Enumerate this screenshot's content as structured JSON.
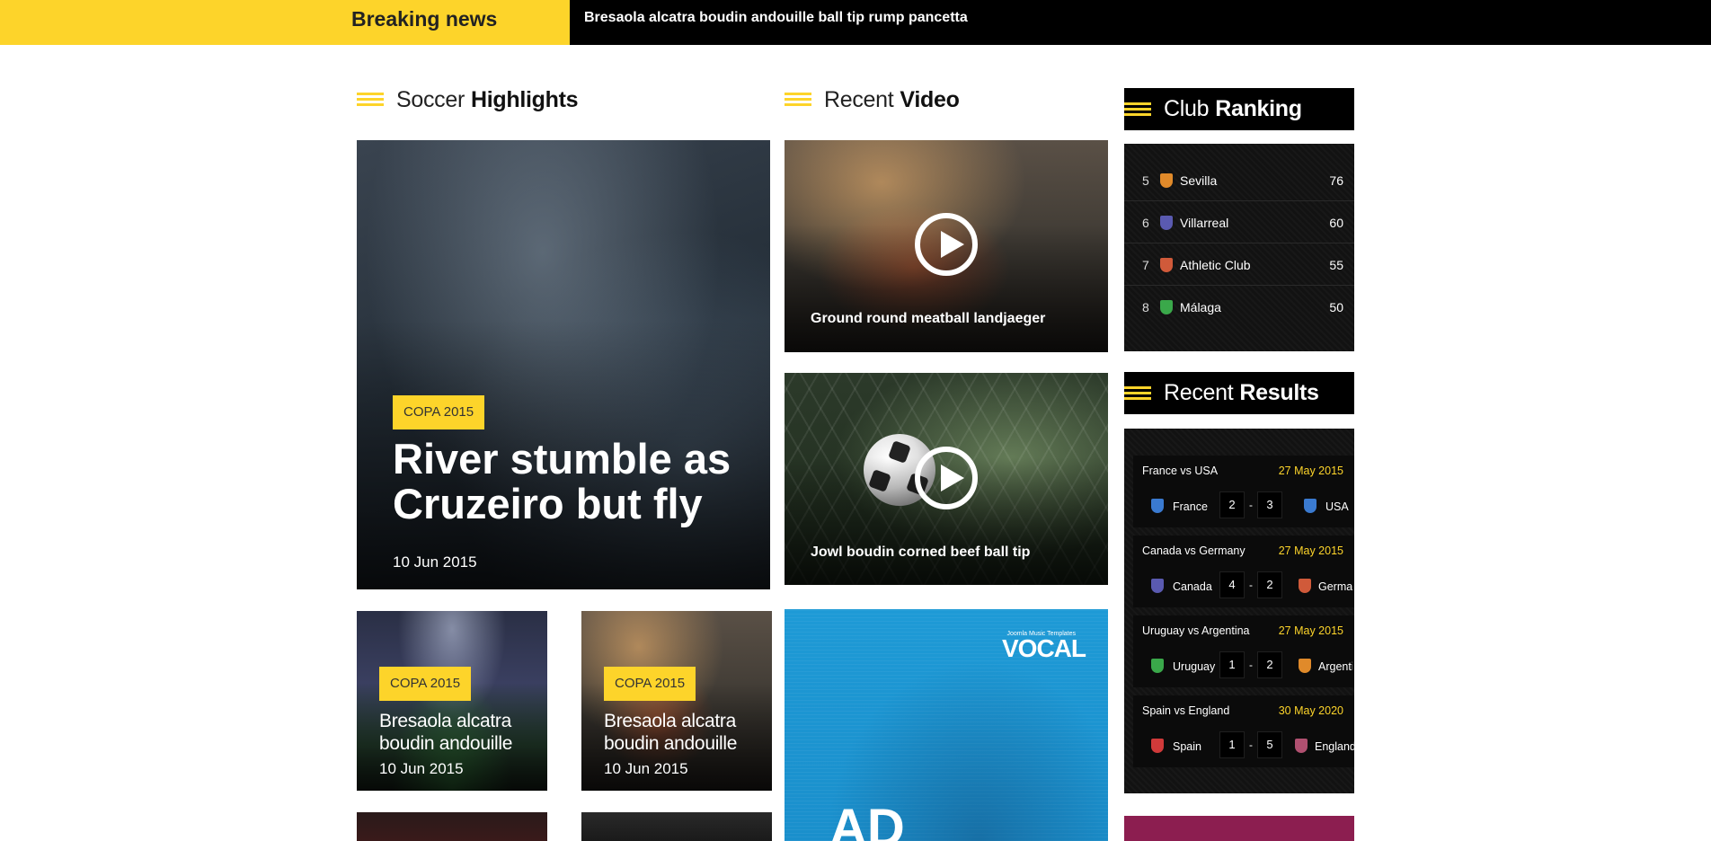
{
  "breaking": {
    "label": "Breaking news",
    "text": "Bresaola alcatra boudin andouille ball tip rump pancetta"
  },
  "sections": {
    "soccer_highlights": {
      "light": "Soccer",
      "bold": "Highlights"
    },
    "recent_video": {
      "light": "Recent",
      "bold": "Video"
    },
    "club_ranking": {
      "light": "Club",
      "bold": "Ranking"
    },
    "recent_results": {
      "light": "Recent",
      "bold": "Results"
    }
  },
  "highlights": {
    "main": {
      "tag": "COPA 2015",
      "title": "River stumble as Cruzeiro but fly",
      "date": "10 Jun 2015"
    },
    "small": [
      {
        "tag": "COPA 2015",
        "title": "Bresaola alcatra boudin andouille",
        "date": "10 Jun 2015"
      },
      {
        "tag": "COPA 2015",
        "title": "Bresaola alcatra boudin andouille",
        "date": "10 Jun 2015"
      }
    ]
  },
  "videos": [
    {
      "title": "Ground round meatball landjaeger"
    },
    {
      "title": "Jowl boudin corned beef ball tip"
    }
  ],
  "ad": {
    "brand": "VOCAL",
    "subtitle": "Joomla Music Templates",
    "text": "AD"
  },
  "ranking": [
    {
      "pos": "5",
      "team": "Sevilla",
      "points": "76",
      "color": "#e08a2a"
    },
    {
      "pos": "6",
      "team": "Villarreal",
      "points": "60",
      "color": "#5a5ab0"
    },
    {
      "pos": "7",
      "team": "Athletic Club",
      "points": "55",
      "color": "#d05a3a"
    },
    {
      "pos": "8",
      "team": "Málaga",
      "points": "50",
      "color": "#3aa84a"
    }
  ],
  "results": [
    {
      "title": "France vs USA",
      "date": "27 May 2015",
      "home": "France",
      "home_score": "2",
      "away_score": "3",
      "away": "USA",
      "home_color": "#3a7ad0",
      "away_color": "#3a7ad0"
    },
    {
      "title": "Canada vs Germany",
      "date": "27 May 2015",
      "home": "Canada",
      "home_score": "4",
      "away_score": "2",
      "away": "German",
      "home_color": "#5a5ab0",
      "away_color": "#d05a3a"
    },
    {
      "title": "Uruguay vs Argentina",
      "date": "27 May 2015",
      "home": "Uruguay",
      "home_score": "1",
      "away_score": "2",
      "away": "Argentin",
      "home_color": "#3aa84a",
      "away_color": "#e08a2a"
    },
    {
      "title": "Spain vs England",
      "date": "30 May 2020",
      "home": "Spain",
      "home_score": "1",
      "away_score": "5",
      "away": "England",
      "home_color": "#d03a3a",
      "away_color": "#b05070"
    }
  ],
  "colors": {
    "accent": "#fdd42a",
    "dark": "#000000",
    "panel": "#121212",
    "promo": "#8c1e50"
  }
}
